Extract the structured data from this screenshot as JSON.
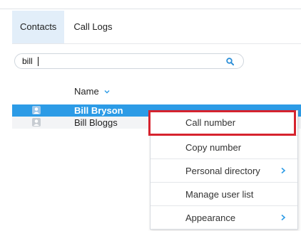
{
  "tabs": [
    {
      "label": "Contacts",
      "active": true
    },
    {
      "label": "Call Logs",
      "active": false
    }
  ],
  "search": {
    "value": "bill",
    "placeholder": ""
  },
  "list": {
    "column_header": "Name",
    "contacts": [
      {
        "name": "Bill Bryson",
        "selected": true
      },
      {
        "name": "Bill Bloggs",
        "selected": false
      }
    ]
  },
  "context_menu": {
    "items": [
      {
        "label": "Call number",
        "submenu": false,
        "highlighted": true
      },
      {
        "label": "Copy number",
        "submenu": false
      },
      {
        "label": "Personal directory",
        "submenu": true
      },
      {
        "label": "Manage user list",
        "submenu": false
      },
      {
        "label": "Appearance",
        "submenu": true
      }
    ]
  },
  "colors": {
    "accent": "#2c9be6",
    "active_tab_bg": "#e2eef9",
    "highlight_border": "#d6232e"
  },
  "icons": {
    "search": "search-icon",
    "sort": "chevron-down-icon",
    "avatar": "contact-avatar-icon",
    "submenu": "chevron-right-icon"
  }
}
